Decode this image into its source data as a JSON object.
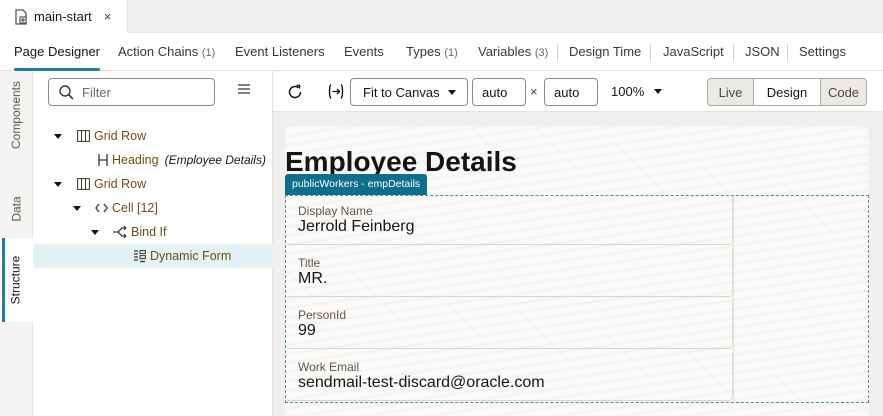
{
  "file_tab": {
    "name": "main-start",
    "close": "×"
  },
  "designer_tabs": [
    {
      "label": "Page Designer",
      "count": ""
    },
    {
      "label": "Action Chains",
      "count": "(1)"
    },
    {
      "label": "Event Listeners",
      "count": ""
    },
    {
      "label": "Events",
      "count": ""
    },
    {
      "label": "Types",
      "count": "(1)"
    },
    {
      "label": "Variables",
      "count": "(3)"
    },
    {
      "label": "Design Time",
      "count": ""
    },
    {
      "label": "JavaScript",
      "count": ""
    },
    {
      "label": "JSON",
      "count": ""
    },
    {
      "label": "Settings",
      "count": ""
    }
  ],
  "side_tabs": [
    "Components",
    "Data",
    "Structure"
  ],
  "structure": {
    "filter_placeholder": "Filter",
    "tree": [
      {
        "label": "Grid Row",
        "icon": "grid-row-icon"
      },
      {
        "label": "Heading",
        "sub": "(Employee Details)",
        "icon": "heading-icon"
      },
      {
        "label": "Grid Row",
        "icon": "grid-row-icon"
      },
      {
        "label": "Cell [12]",
        "icon": "code-icon"
      },
      {
        "label": "Bind If",
        "icon": "bind-if-icon"
      },
      {
        "label": "Dynamic Form",
        "icon": "form-icon"
      }
    ]
  },
  "toolbar": {
    "fit": "Fit to Canvas",
    "width": "auto",
    "times": "×",
    "height": "auto",
    "zoom": "100%",
    "modes": [
      "Live",
      "Design",
      "Code"
    ],
    "active_mode": "Design"
  },
  "canvas": {
    "title": "Employee Details",
    "chip": "publicWorkers - empDetails",
    "fields": [
      {
        "label": "Display Name",
        "value": "Jerrold Feinberg"
      },
      {
        "label": "Title",
        "value": "MR."
      },
      {
        "label": "PersonId",
        "value": "99"
      },
      {
        "label": "Work Email",
        "value": "sendmail-test-discard@oracle.com"
      }
    ]
  },
  "colors": {
    "accent": "#227e9e",
    "chip": "#0f6e8c",
    "selection": "#e4f1f6"
  }
}
